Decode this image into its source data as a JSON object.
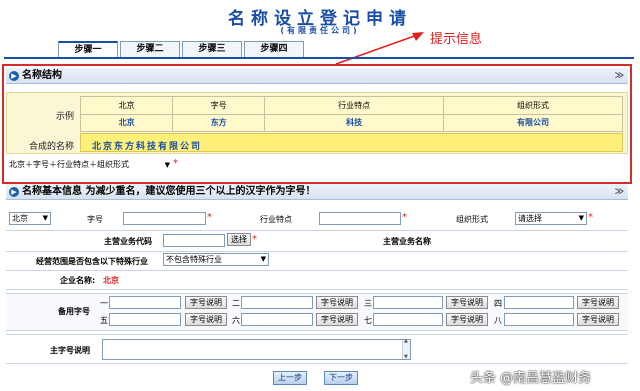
{
  "header": {
    "title": "名称设立登记申请",
    "subtitle": "(有限责任公司)"
  },
  "annotation": {
    "tip": "提示信息",
    "color": "#e0201c"
  },
  "tabs": [
    {
      "label": "步骤一"
    },
    {
      "label": "步骤二"
    },
    {
      "label": "步骤三"
    },
    {
      "label": "步骤四"
    }
  ],
  "structure": {
    "section_title": "名称结构",
    "example_label": "示例",
    "columns": [
      "北京",
      "字号",
      "行业特点",
      "组织形式"
    ],
    "values": [
      "北京",
      "东方",
      "科技",
      "有限公司"
    ],
    "composite_label": "合成的名称",
    "composite_value": "北京东方科技有限公司",
    "pattern_select": "北京＋字号＋行业特点＋组织形式"
  },
  "basic": {
    "section_title": "名称基本信息 为减少重名，建议您使用三个以上的汉字作为字号！",
    "region_select": "北京",
    "trade_name_label": "字号",
    "trade_name_value": "",
    "industry_label": "行业特点",
    "industry_value": "",
    "org_form_label": "组织形式",
    "org_form_select": "请选择",
    "main_business_code_label": "主营业务代码",
    "main_business_code_value": "",
    "select_button": "选择",
    "main_business_name_label": "主营业务名称",
    "scope_label": "经营范围是否包含以下特殊行业",
    "scope_select": "不包含特殊行业",
    "company_name_label": "企业名称:",
    "company_name_value": "北京"
  },
  "backup": {
    "label": "备用字号",
    "slots": [
      {
        "num": "一",
        "button": "字号说明"
      },
      {
        "num": "二",
        "button": "字号说明"
      },
      {
        "num": "三",
        "button": "字号说明"
      },
      {
        "num": "四",
        "button": "字号说明"
      },
      {
        "num": "五",
        "button": "字号说明"
      },
      {
        "num": "六",
        "button": "字号说明"
      },
      {
        "num": "七",
        "button": "字号说明"
      },
      {
        "num": "八",
        "button": "字号说明"
      }
    ]
  },
  "main_desc": {
    "label": "主字号说明",
    "value": ""
  },
  "footer": {
    "prev": "上一步",
    "next": "下一步"
  },
  "watermark": "头条 @南昌慧盈财务",
  "colors": {
    "accent": "#1a4fa8",
    "required": "#e0201c",
    "highlight": "#fff07a"
  }
}
